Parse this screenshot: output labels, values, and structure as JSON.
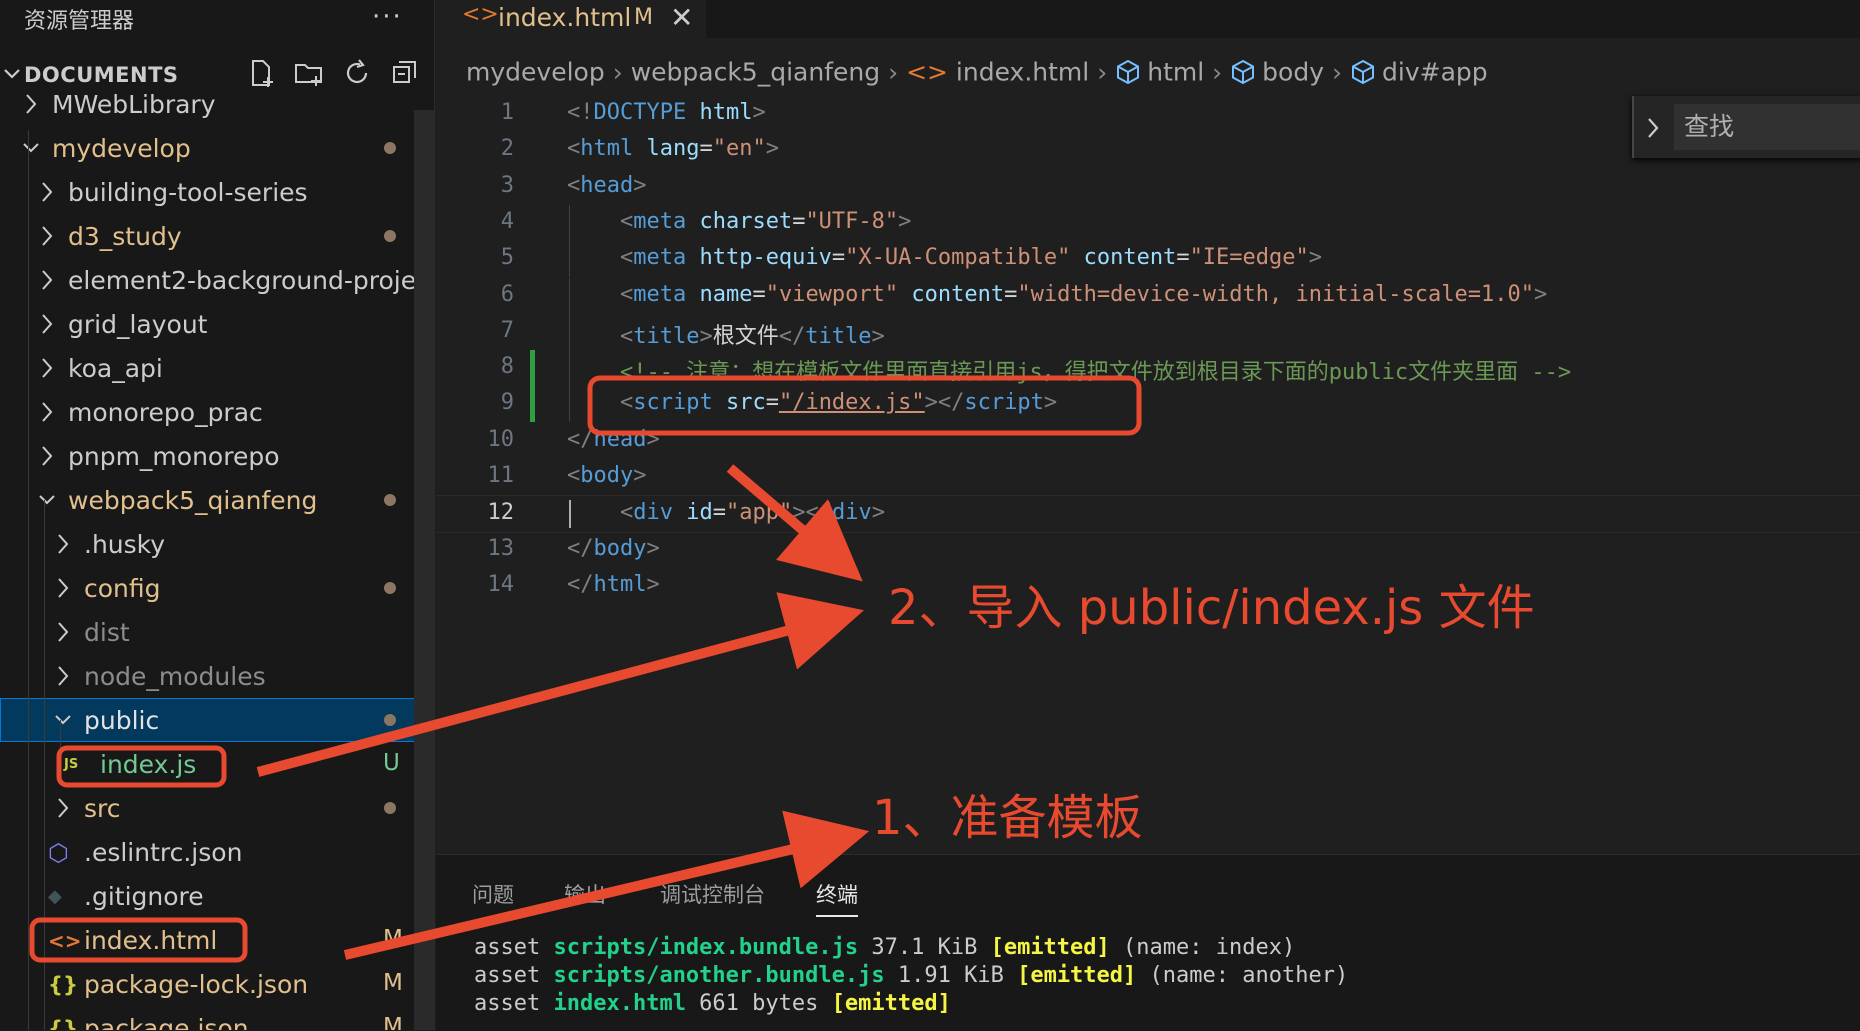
{
  "sidebar": {
    "title": "资源管理器",
    "more_label": "···",
    "section_title": "DOCUMENTS",
    "rows": [
      {
        "label": "MWebLibrary",
        "kind": "folder",
        "state": "collapsed",
        "color": "#cccccc"
      },
      {
        "label": "mydevelop",
        "kind": "folder",
        "state": "expanded",
        "color": "#e2c08d",
        "dot": true
      },
      {
        "label": "building-tool-series",
        "kind": "folder",
        "state": "collapsed",
        "color": "#cccccc"
      },
      {
        "label": "d3_study",
        "kind": "folder",
        "state": "collapsed",
        "color": "#e2c08d",
        "dot": true
      },
      {
        "label": "element2-background-proje...",
        "kind": "folder",
        "state": "collapsed",
        "color": "#cccccc"
      },
      {
        "label": "grid_layout",
        "kind": "folder",
        "state": "collapsed",
        "color": "#cccccc"
      },
      {
        "label": "koa_api",
        "kind": "folder",
        "state": "collapsed",
        "color": "#cccccc"
      },
      {
        "label": "monorepo_prac",
        "kind": "folder",
        "state": "collapsed",
        "color": "#cccccc"
      },
      {
        "label": "pnpm_monorepo",
        "kind": "folder",
        "state": "collapsed",
        "color": "#cccccc"
      },
      {
        "label": "webpack5_qianfeng",
        "kind": "folder",
        "state": "expanded",
        "color": "#e2c08d",
        "dot": true
      },
      {
        "label": ".husky",
        "kind": "folder",
        "state": "collapsed",
        "color": "#cccccc"
      },
      {
        "label": "config",
        "kind": "folder",
        "state": "collapsed",
        "color": "#e2c08d",
        "dot": true
      },
      {
        "label": "dist",
        "kind": "folder",
        "state": "collapsed",
        "color": "#8c8c8c"
      },
      {
        "label": "node_modules",
        "kind": "folder",
        "state": "collapsed",
        "color": "#8c8c8c"
      },
      {
        "label": "public",
        "kind": "folder",
        "state": "expanded",
        "color": "#e2e2e2",
        "dot": true,
        "selected": true
      },
      {
        "label": "index.js",
        "kind": "js",
        "color": "#73c991",
        "badge": "U",
        "badge_color": "#73c991"
      },
      {
        "label": "src",
        "kind": "folder",
        "state": "collapsed",
        "color": "#e2c08d",
        "dot": true
      },
      {
        "label": ".eslintrc.json",
        "kind": "eslint",
        "color": "#cccccc"
      },
      {
        "label": ".gitignore",
        "kind": "git",
        "color": "#cccccc"
      },
      {
        "label": "index.html",
        "kind": "html",
        "color": "#e2c08d",
        "badge": "M",
        "badge_color": "#e2c08d"
      },
      {
        "label": "package-lock.json",
        "kind": "json",
        "color": "#e2c08d",
        "badge": "M",
        "badge_color": "#e2c08d"
      },
      {
        "label": "package.json",
        "kind": "json",
        "color": "#e2c08d",
        "badge": "M",
        "badge_color": "#e2c08d"
      }
    ]
  },
  "tab": {
    "label": "index.html",
    "badge": "M",
    "close": "✕"
  },
  "breadcrumbs": [
    "mydevelop",
    "webpack5_qianfeng",
    "index.html",
    "html",
    "body",
    "div#app"
  ],
  "find": {
    "placeholder": "查找"
  },
  "code_lines": [
    [
      [
        "<!",
        "t-br"
      ],
      [
        "DOCTYPE",
        "t-tag"
      ],
      [
        " html",
        "t-at"
      ],
      [
        ">",
        "t-br"
      ]
    ],
    [
      [
        "<",
        "t-br"
      ],
      [
        "html",
        "t-tag"
      ],
      [
        " lang",
        "t-at"
      ],
      [
        "=",
        "t-tx"
      ],
      [
        "\"en\"",
        "t-st"
      ],
      [
        ">",
        "t-br"
      ]
    ],
    [
      [
        "<",
        "t-br"
      ],
      [
        "head",
        "t-tag"
      ],
      [
        ">",
        "t-br"
      ]
    ],
    [
      [
        "    <",
        "t-br"
      ],
      [
        "meta",
        "t-tag"
      ],
      [
        " charset",
        "t-at"
      ],
      [
        "=",
        "t-tx"
      ],
      [
        "\"UTF-8\"",
        "t-st"
      ],
      [
        ">",
        "t-br"
      ]
    ],
    [
      [
        "    <",
        "t-br"
      ],
      [
        "meta",
        "t-tag"
      ],
      [
        " http-equiv",
        "t-at"
      ],
      [
        "=",
        "t-tx"
      ],
      [
        "\"X-UA-Compatible\"",
        "t-st"
      ],
      [
        " content",
        "t-at"
      ],
      [
        "=",
        "t-tx"
      ],
      [
        "\"IE=edge\"",
        "t-st"
      ],
      [
        ">",
        "t-br"
      ]
    ],
    [
      [
        "    <",
        "t-br"
      ],
      [
        "meta",
        "t-tag"
      ],
      [
        " name",
        "t-at"
      ],
      [
        "=",
        "t-tx"
      ],
      [
        "\"viewport\"",
        "t-st"
      ],
      [
        " content",
        "t-at"
      ],
      [
        "=",
        "t-tx"
      ],
      [
        "\"width=device-width, initial-scale=1.0\"",
        "t-st"
      ],
      [
        ">",
        "t-br"
      ]
    ],
    [
      [
        "    <",
        "t-br"
      ],
      [
        "title",
        "t-tag"
      ],
      [
        ">",
        "t-br"
      ],
      [
        "根文件",
        "t-tx"
      ],
      [
        "</",
        "t-br"
      ],
      [
        "title",
        "t-tag"
      ],
      [
        ">",
        "t-br"
      ]
    ],
    [
      [
        "    <!-- 注意：想在模板文件里面直接引用js，得把文件放到根目录下面的public文件夹里面 -->",
        "t-cm"
      ]
    ],
    [
      [
        "    <",
        "t-br"
      ],
      [
        "script",
        "t-tag"
      ],
      [
        " src",
        "t-at"
      ],
      [
        "=",
        "t-tx"
      ],
      [
        "\"/index.js\"",
        "t-st"
      ],
      [
        "></",
        "t-br"
      ],
      [
        "script",
        "t-tag"
      ],
      [
        ">",
        "t-br"
      ]
    ],
    [
      [
        "</",
        "t-br"
      ],
      [
        "head",
        "t-tag"
      ],
      [
        ">",
        "t-br"
      ]
    ],
    [
      [
        "<",
        "t-br"
      ],
      [
        "body",
        "t-tag"
      ],
      [
        ">",
        "t-br"
      ]
    ],
    [
      [
        "    <",
        "t-br"
      ],
      [
        "div",
        "t-tag"
      ],
      [
        " id",
        "t-at"
      ],
      [
        "=",
        "t-tx"
      ],
      [
        "\"app\"",
        "t-st"
      ],
      [
        "></",
        "t-br"
      ],
      [
        "div",
        "t-tag"
      ],
      [
        ">",
        "t-br"
      ]
    ],
    [
      [
        "</",
        "t-br"
      ],
      [
        "body",
        "t-tag"
      ],
      [
        ">",
        "t-br"
      ]
    ],
    [
      [
        "</",
        "t-br"
      ],
      [
        "html",
        "t-tag"
      ],
      [
        ">",
        "t-br"
      ]
    ]
  ],
  "panel": {
    "tabs": [
      "问题",
      "输出",
      "调试控制台",
      "终端"
    ],
    "active_tab": "终端",
    "terminal_lines": [
      [
        [
          "asset ",
          ""
        ],
        [
          "scripts/index.bundle.js",
          "tg"
        ],
        [
          " 37.1 KiB ",
          ""
        ],
        [
          "[emitted]",
          "ty"
        ],
        [
          " (name: index)",
          ""
        ]
      ],
      [
        [
          "asset ",
          ""
        ],
        [
          "scripts/another.bundle.js",
          "tg"
        ],
        [
          " 1.91 KiB ",
          ""
        ],
        [
          "[emitted]",
          "ty"
        ],
        [
          " (name: another)",
          ""
        ]
      ],
      [
        [
          "asset ",
          ""
        ],
        [
          "index.html",
          "tg"
        ],
        [
          " 661 bytes ",
          ""
        ],
        [
          "[emitted]",
          "ty"
        ]
      ]
    ]
  },
  "annotations": {
    "note_import": "2、导入 public/index.js 文件",
    "note_template": "1、准备模板"
  },
  "colors": {
    "annotation_red": "#e84a2f",
    "modified": "#e2c08d",
    "untracked": "#73c991",
    "selection": "#04395e",
    "focus_border": "#0078d4"
  }
}
